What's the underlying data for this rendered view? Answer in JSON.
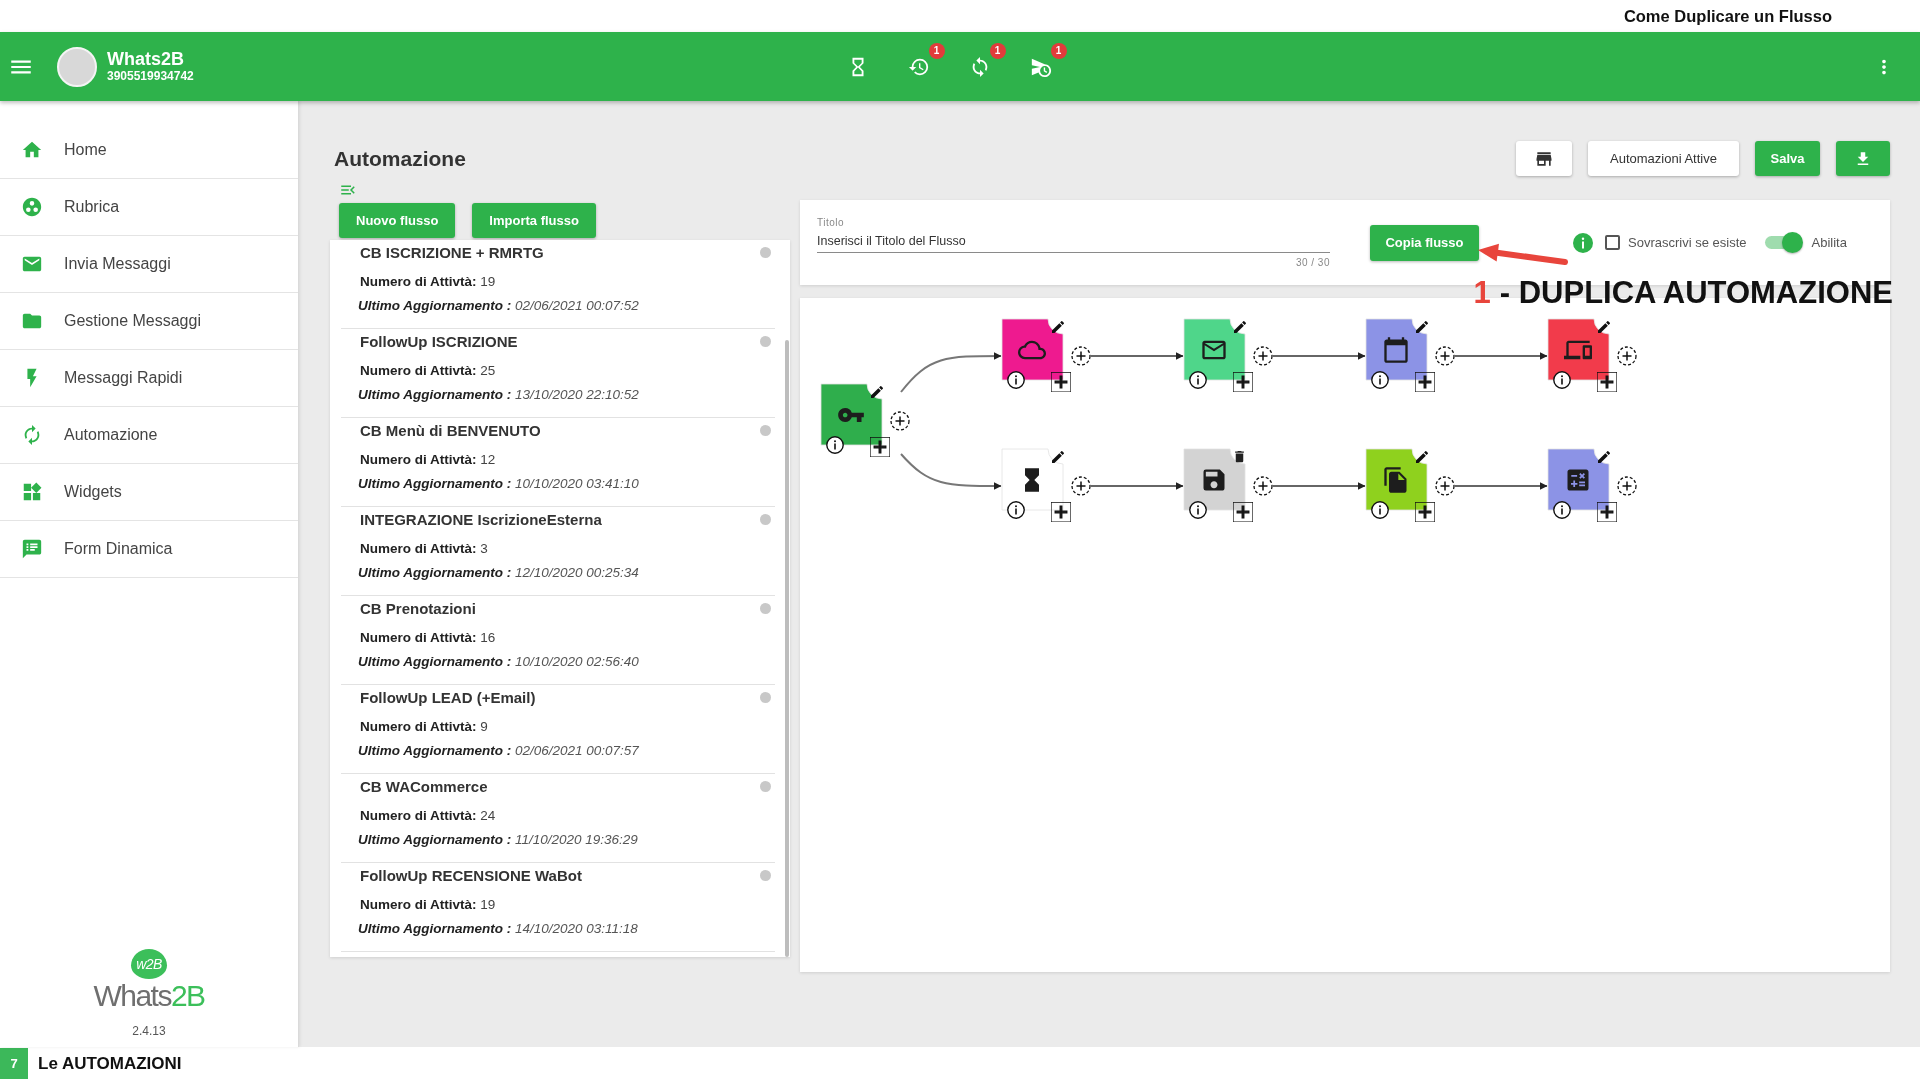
{
  "page_title": "Come Duplicare un Flusso",
  "header": {
    "name": "Whats2B",
    "phone": "3905519934742",
    "actions": [
      {
        "kind": "waiting"
      },
      {
        "kind": "history",
        "badge": "1"
      },
      {
        "kind": "sync",
        "badge": "1"
      },
      {
        "kind": "scheduled",
        "badge": "1"
      }
    ]
  },
  "sidebar": {
    "items": [
      {
        "label": "Home"
      },
      {
        "label": "Rubrica"
      },
      {
        "label": "Invia Messaggi"
      },
      {
        "label": "Gestione Messaggi"
      },
      {
        "label": "Messaggi Rapidi"
      },
      {
        "label": "Automazione"
      },
      {
        "label": "Widgets"
      },
      {
        "label": "Form Dinamica"
      }
    ],
    "logo": {
      "badge": "w2B",
      "wordmark": "Whats**2B**"
    },
    "version": "2.4.13"
  },
  "main": {
    "title": "Automazione",
    "toolbar": [
      {
        "kind": "shop"
      },
      {
        "kind": "text",
        "label": "Automazioni Attive"
      },
      {
        "kind": "primary",
        "label": "Salva"
      },
      {
        "kind": "download"
      }
    ],
    "flow_buttons": [
      "Nuovo flusso",
      "Importa flusso"
    ],
    "flows": [
      {
        "name": "CB ISCRIZIONE + RMRTG",
        "activities": "**Numero di Attivtà:** 19",
        "updated": "**Ultimo Aggiornamento :** 02/06/2021 00:07:52"
      },
      {
        "name": "FollowUp ISCRIZIONE",
        "activities": "**Numero di Attivtà:** 25",
        "updated": "**Ultimo Aggiornamento :** 13/10/2020 22:10:52"
      },
      {
        "name": "CB Menù di BENVENUTO",
        "activities": "**Numero di Attivtà:** 12",
        "updated": "**Ultimo Aggiornamento :** 10/10/2020 03:41:10"
      },
      {
        "name": "INTEGRAZIONE IscrizioneEsterna",
        "activities": "**Numero di Attivtà:** 3",
        "updated": "**Ultimo Aggiornamento :** 12/10/2020 00:25:34"
      },
      {
        "name": "CB Prenotazioni",
        "activities": "**Numero di Attivtà:** 16",
        "updated": "**Ultimo Aggiornamento :** 10/10/2020 02:56:40"
      },
      {
        "name": "FollowUp LEAD (+Email)",
        "activities": "**Numero di Attivtà:** 9",
        "updated": "**Ultimo Aggiornamento :** 02/06/2021 00:07:57"
      },
      {
        "name": "CB WACommerce",
        "activities": "**Numero di Attivtà:** 24",
        "updated": "**Ultimo Aggiornamento :** 11/10/2020 19:36:29"
      },
      {
        "name": "FollowUp RECENSIONE WaBot",
        "activities": "**Numero di Attivtà:** 19",
        "updated": "**Ultimo Aggiornamento :** 14/10/2020 03:11:18"
      }
    ],
    "form": {
      "title_field": {
        "label": "Titolo",
        "value": "Inserisci il Titolo del Flusso",
        "counter": "30 / 30"
      },
      "copy_button": "Copia flusso",
      "overwrite": {
        "label": "Sovrascrivi se esiste",
        "checked": false
      },
      "enable": {
        "label": "Abilita",
        "on": true
      }
    },
    "canvas": {
      "start": {
        "kind": "trigger",
        "color": "#2fae4c",
        "deletable": false
      },
      "branches": [
        [
          {
            "kind": "api",
            "color": "#ee1a8f",
            "deletable": false
          },
          {
            "kind": "email",
            "color": "#4fd68a",
            "deletable": false
          },
          {
            "kind": "calendar",
            "color": "#8c93e6",
            "deletable": false
          },
          {
            "kind": "device",
            "color": "#f23b4b",
            "deletable": false
          }
        ],
        [
          {
            "kind": "wait",
            "color": "#ffffff",
            "deletable": false
          },
          {
            "kind": "save",
            "color": "#d3d3d3",
            "deletable": true
          },
          {
            "kind": "document",
            "color": "#8fd11e",
            "deletable": false
          },
          {
            "kind": "calculator",
            "color": "#8c93e6",
            "deletable": false
          }
        ]
      ]
    }
  },
  "annotation": {
    "number": "1",
    "text": "- DUPLICA AUTOMAZIONE"
  },
  "footer": {
    "slide": "7",
    "title": "Le AUTOMAZIONI"
  }
}
